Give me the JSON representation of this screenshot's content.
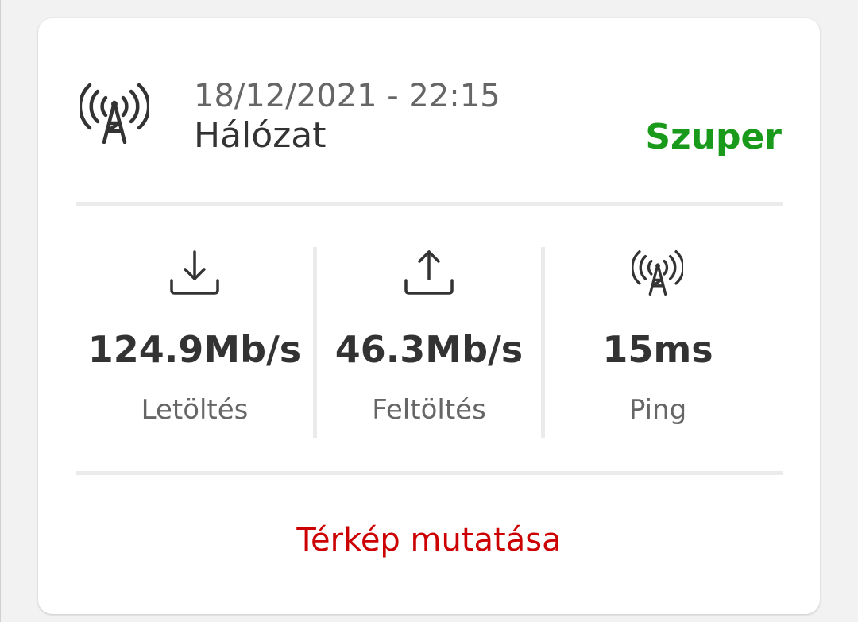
{
  "header": {
    "datetime": "18/12/2021 - 22:15",
    "title": "Hálózat",
    "quality": "Szuper",
    "icon": "antenna-icon"
  },
  "metrics": [
    {
      "icon": "download-icon",
      "value": "124.9Mb/s",
      "label": "Letöltés"
    },
    {
      "icon": "upload-icon",
      "value": "46.3Mb/s",
      "label": "Feltöltés"
    },
    {
      "icon": "antenna-icon",
      "value": "15ms",
      "label": "Ping"
    }
  ],
  "footer": {
    "map_link": "Térkép mutatása"
  },
  "colors": {
    "quality_green": "#1a9a1a",
    "link_red": "#cc0000"
  }
}
